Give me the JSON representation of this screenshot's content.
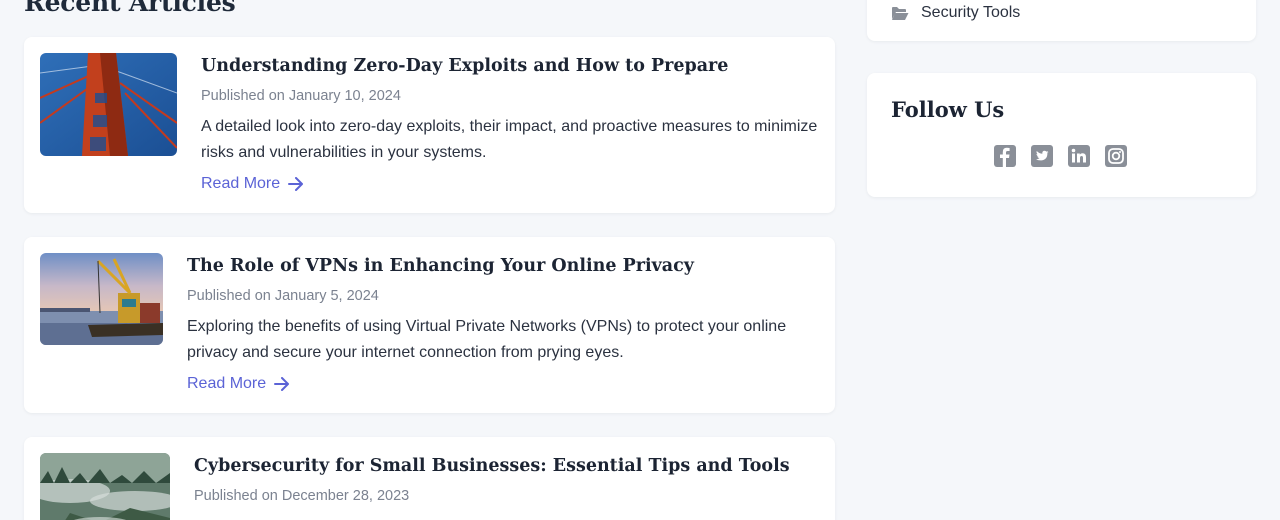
{
  "main": {
    "section_title": "Recent Articles",
    "read_more_label": "Read More",
    "articles": [
      {
        "title": "Understanding Zero-Day Exploits and How to Prepare",
        "date": "Published on January 10, 2024",
        "excerpt": "A detailed look into zero-day exploits, their impact, and proactive measures to minimize risks and vulnerabilities in your systems.",
        "image": "golden-gate-bridge-tower"
      },
      {
        "title": "The Role of VPNs in Enhancing Your Online Privacy",
        "date": "Published on January 5, 2024",
        "excerpt": "Exploring the benefits of using Virtual Private Networks (VPNs) to protect your online privacy and secure your internet connection from prying eyes.",
        "image": "harbor-crane-ship"
      },
      {
        "title": "Cybersecurity for Small Businesses: Essential Tips and Tools",
        "date": "Published on December 28, 2023",
        "excerpt": "",
        "image": "misty-forest-valley"
      }
    ]
  },
  "sidebar": {
    "categories": {
      "visible_item": {
        "label": "Security Tools",
        "icon": "folder-open-icon"
      }
    },
    "follow": {
      "title": "Follow Us",
      "icons": [
        "facebook-icon",
        "twitter-icon",
        "linkedin-icon",
        "instagram-icon"
      ]
    }
  },
  "colors": {
    "accent": "#5b63d6",
    "background": "#f5f7fa",
    "card": "#ffffff",
    "social_icon": "#8a8f98"
  }
}
